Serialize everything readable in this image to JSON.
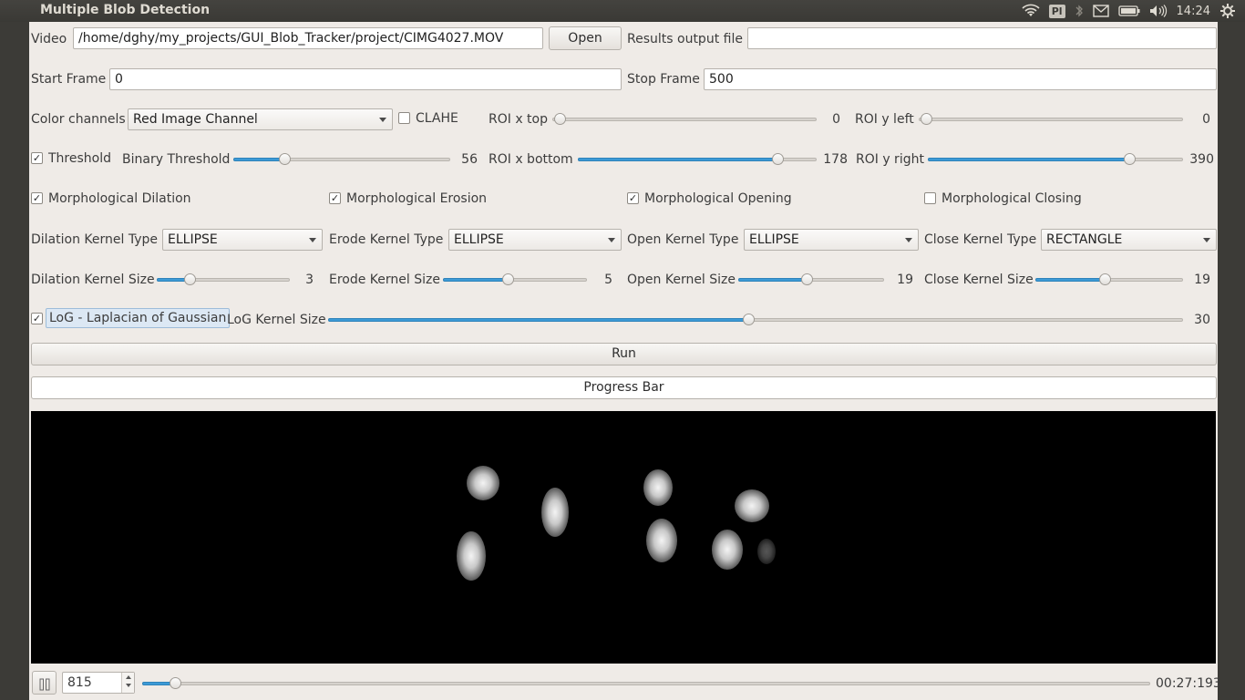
{
  "app_title": "Multiple Blob Detection",
  "tray": {
    "indicator": "Pl",
    "clock": "14:24"
  },
  "row1": {
    "video_label": "Video",
    "video_path": "/home/dghy/my_projects/GUI_Blob_Tracker/project/CIMG4027.MOV",
    "open_button": "Open",
    "results_label": "Results output file",
    "results_value": ""
  },
  "row2": {
    "start_label": "Start Frame",
    "start_value": "0",
    "stop_label": "Stop Frame",
    "stop_value": "500"
  },
  "row3": {
    "color_label": "Color channels",
    "color_value": "Red Image Channel",
    "clahe_label": "CLAHE",
    "clahe_checked": false,
    "roi_x_top_label": "ROI x top",
    "roi_x_top_value": "0",
    "roi_y_left_label": "ROI y left",
    "roi_y_left_value": "0"
  },
  "row4": {
    "threshold_label": "Threshold",
    "threshold_checked": true,
    "binary_label": "Binary Threshold",
    "binary_value": "56",
    "roi_x_bottom_label": "ROI x bottom",
    "roi_x_bottom_value": "178",
    "roi_y_right_label": "ROI y right",
    "roi_y_right_value": "390"
  },
  "row5": {
    "dilation_label": "Morphological Dilation",
    "erosion_label": "Morphological Erosion",
    "opening_label": "Morphological Opening",
    "closing_label": "Morphological Closing"
  },
  "row6": {
    "dil_kernel_label": "Dilation Kernel Type",
    "dil_kernel_value": "ELLIPSE",
    "ero_kernel_label": "Erode Kernel Type",
    "ero_kernel_value": "ELLIPSE",
    "open_kernel_label": "Open Kernel Type",
    "open_kernel_value": "ELLIPSE",
    "close_kernel_label": "Close Kernel Type",
    "close_kernel_value": "RECTANGLE"
  },
  "row7": {
    "dil_size_label": "Dilation Kernel Size",
    "dil_size_value": "3",
    "ero_size_label": "Erode Kernel Size",
    "ero_size_value": "5",
    "open_size_label": "Open Kernel Size",
    "open_size_value": "19",
    "close_size_label": "Close Kernel Size",
    "close_size_value": "19"
  },
  "row8": {
    "log_label": "LoG - Laplacian of Gaussian",
    "log_size_label": "LoG Kernel Size",
    "log_size_value": "30"
  },
  "run_button": "Run",
  "progress_label": "Progress Bar",
  "player": {
    "frame_value": "815",
    "time": "00:27:193"
  },
  "colors": {
    "accent": "#3c9ad6",
    "window_bg": "#efebe7",
    "topbar": "#3c3b37"
  },
  "icons": [
    "wifi-icon",
    "bluetooth-icon",
    "mail-icon",
    "battery-icon",
    "volume-icon",
    "settings-gear-icon",
    "pause-icon"
  ]
}
